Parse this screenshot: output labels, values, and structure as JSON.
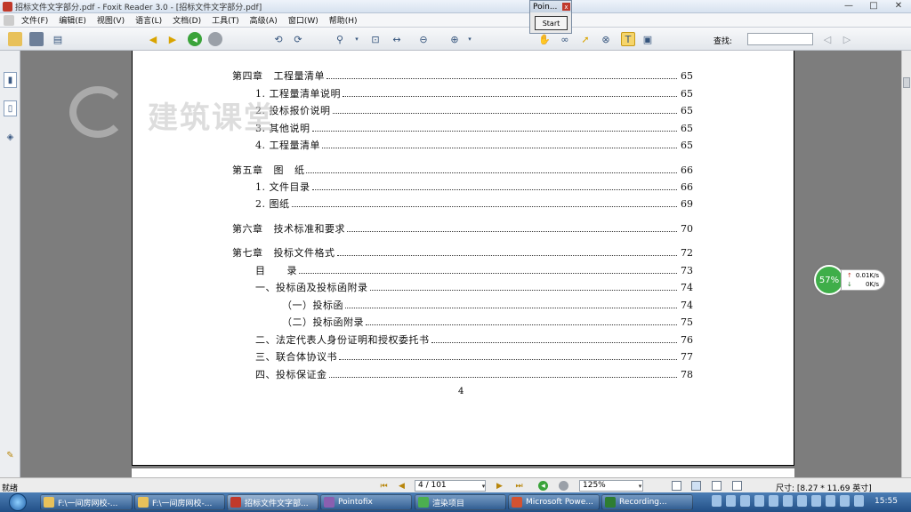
{
  "window": {
    "title": "招标文件文字部分.pdf - Foxit Reader 3.0 - [招标文件文字部分.pdf]",
    "minimize": "—",
    "maximize": "□",
    "close": "✕"
  },
  "menu": [
    "文件(F)",
    "编辑(E)",
    "视图(V)",
    "语言(L)",
    "文档(D)",
    "工具(T)",
    "高级(A)",
    "窗口(W)",
    "帮助(H)"
  ],
  "toolbar": {
    "find_label": "查找:"
  },
  "watermark": {
    "text": "建筑课堂"
  },
  "toc": [
    {
      "label": "第四章   工程量清单",
      "page": "65",
      "indent": 0
    },
    {
      "label": "1. 工程量清单说明",
      "page": "65",
      "indent": 1
    },
    {
      "label": "2. 投标报价说明",
      "page": "65",
      "indent": 1
    },
    {
      "label": "3. 其他说明",
      "page": "65",
      "indent": 1
    },
    {
      "label": "4. 工程量清单",
      "page": "65",
      "indent": 1
    },
    {
      "label": "第五章   图   纸",
      "page": "66",
      "indent": 0
    },
    {
      "label": "1. 文件目录",
      "page": "66",
      "indent": 1
    },
    {
      "label": "2. 图纸",
      "page": "69",
      "indent": 1
    },
    {
      "label": "第六章   技术标准和要求",
      "page": "70",
      "indent": 0
    },
    {
      "label": "第七章   投标文件格式",
      "page": "72",
      "indent": 0
    },
    {
      "label": "目      录",
      "page": "73",
      "indent": 1
    },
    {
      "label": "一、投标函及投标函附录",
      "page": "74",
      "indent": 1
    },
    {
      "label": "（一）投标函",
      "page": "74",
      "indent": 2
    },
    {
      "label": "（二）投标函附录",
      "page": "75",
      "indent": 2
    },
    {
      "label": "二、法定代表人身份证明和授权委托书",
      "page": "76",
      "indent": 1
    },
    {
      "label": "三、联合体协议书",
      "page": "77",
      "indent": 1
    },
    {
      "label": "四、投标保证金",
      "page": "78",
      "indent": 1
    }
  ],
  "page_number_printed": "4",
  "pointofix": {
    "title": "Poin...",
    "close": "x",
    "start_label": "Start"
  },
  "network": {
    "percent": "57%",
    "up": "0.01K/s",
    "down": "0K/s",
    "up_icon": "↑",
    "down_icon": "↓"
  },
  "status": {
    "ready": "就绪",
    "page_field": "4 / 101",
    "zoom": "125%",
    "size": "尺寸: [8.27 * 11.69 英寸]"
  },
  "taskbar": {
    "tasks": [
      "F:\\一间房网校-...",
      "F:\\一间房网校-...",
      "招标文件文字部...",
      "Pointofix",
      "渲染项目",
      "Microsoft Powe...",
      "Recording..."
    ],
    "clock": "15:55"
  }
}
